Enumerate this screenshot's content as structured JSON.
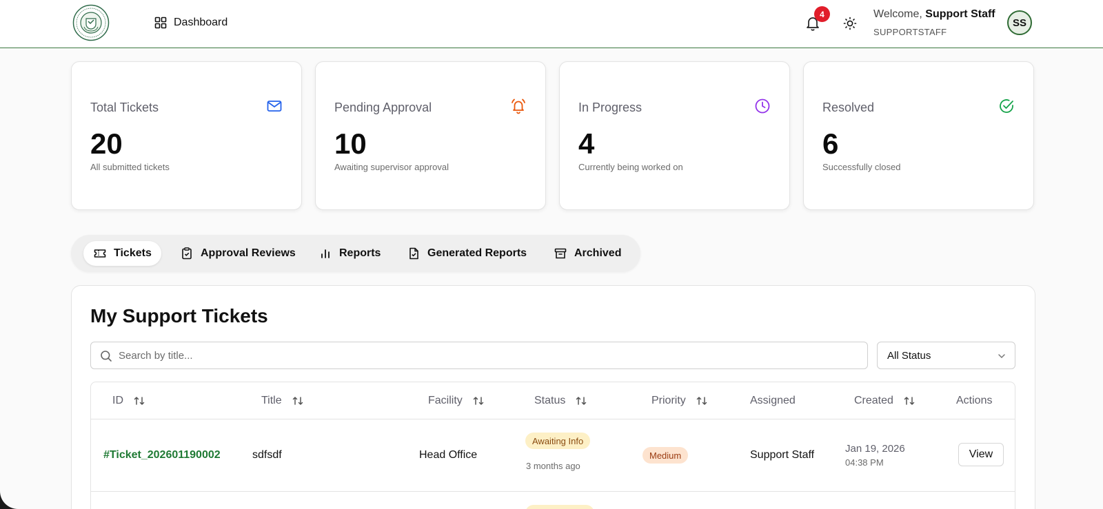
{
  "header": {
    "nav_label": "Dashboard",
    "notification_count": "4",
    "welcome_prefix": "Welcome,",
    "user_name": "Support Staff",
    "user_role": "SUPPORTSTAFF",
    "avatar_initials": "SS",
    "accent_color": "#3d7a40"
  },
  "stats": [
    {
      "title": "Total Tickets",
      "value": "20",
      "subtitle": "All submitted tickets",
      "icon": "mail-icon",
      "color": "#2563eb"
    },
    {
      "title": "Pending Approval",
      "value": "10",
      "subtitle": "Awaiting supervisor approval",
      "icon": "bell-ring-icon",
      "color": "#ea580c"
    },
    {
      "title": "In Progress",
      "value": "4",
      "subtitle": "Currently being worked on",
      "icon": "clock-icon",
      "color": "#9333ea"
    },
    {
      "title": "Resolved",
      "value": "6",
      "subtitle": "Successfully closed",
      "icon": "check-circle-icon",
      "color": "#16a34a"
    }
  ],
  "tabs": [
    {
      "label": "Tickets",
      "icon": "ticket-icon",
      "active": true
    },
    {
      "label": "Approval Reviews",
      "icon": "clipboard-check-icon",
      "active": false
    },
    {
      "label": "Reports",
      "icon": "bar-chart-icon",
      "active": false
    },
    {
      "label": "Generated Reports",
      "icon": "file-check-icon",
      "active": false
    },
    {
      "label": "Archived",
      "icon": "archive-icon",
      "active": false
    }
  ],
  "tickets_panel": {
    "title": "My Support Tickets",
    "search_placeholder": "Search by title...",
    "status_filter": "All Status",
    "columns": [
      "ID",
      "Title",
      "Facility",
      "Status",
      "Priority",
      "Assigned",
      "Created",
      "Actions"
    ],
    "rows": [
      {
        "id": "#Ticket_202601190002",
        "title": "sdfsdf",
        "facility": "Head Office",
        "status": "Awaiting Info",
        "status_age": "3 months ago",
        "priority": "Medium",
        "assigned": "Support Staff",
        "created_date": "Jan 19, 2026",
        "created_time": "04:38 PM",
        "action": "View"
      }
    ]
  }
}
